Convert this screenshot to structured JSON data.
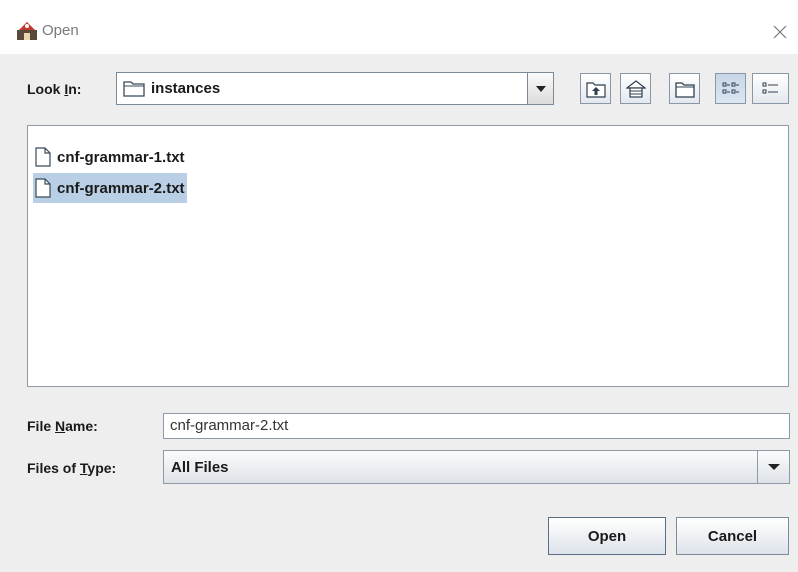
{
  "window": {
    "title": "Open"
  },
  "look_in": {
    "label_prefix": "Look ",
    "label_mnemonic": "I",
    "label_suffix": "n:",
    "value": "instances",
    "value_icon": "folder-icon"
  },
  "toolbar": {
    "buttons": [
      {
        "name": "up-one-level-button",
        "icon": "up-folder-icon"
      },
      {
        "name": "home-button",
        "icon": "home-icon"
      },
      {
        "name": "new-folder-button",
        "icon": "new-folder-icon"
      },
      {
        "name": "list-view-button",
        "icon": "list-view-icon",
        "pressed": true
      },
      {
        "name": "details-view-button",
        "icon": "details-view-icon",
        "pressed": false
      }
    ]
  },
  "files": [
    {
      "name": "cnf-grammar-1.txt",
      "selected": false
    },
    {
      "name": "cnf-grammar-2.txt",
      "selected": true
    }
  ],
  "file_name": {
    "label_prefix": "File ",
    "label_mnemonic": "N",
    "label_suffix": "ame:",
    "value": "cnf-grammar-2.txt"
  },
  "file_type": {
    "label_prefix": "Files of ",
    "label_mnemonic": "T",
    "label_suffix": "ype:",
    "value": "All Files"
  },
  "buttons": {
    "open": "Open",
    "cancel": "Cancel"
  },
  "colors": {
    "dialog_bg": "#eeeeee",
    "selection": "#b8cfe5",
    "border": "#8e9aa7"
  }
}
